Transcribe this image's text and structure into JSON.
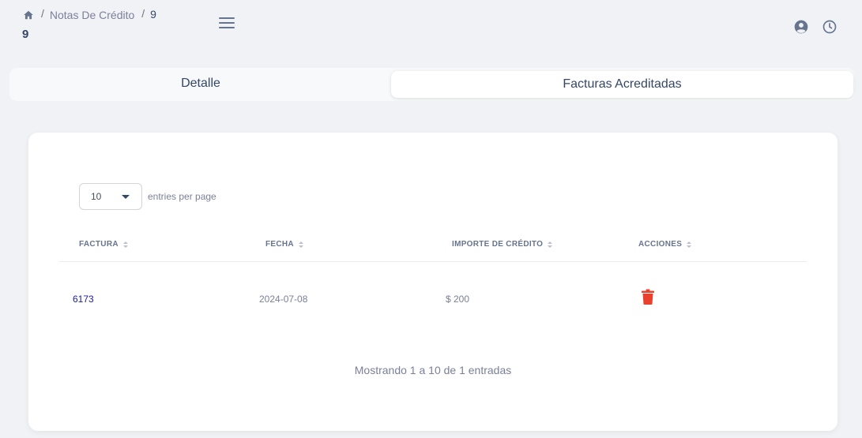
{
  "breadcrumb": {
    "home_icon": "home-icon",
    "separator": "/",
    "link": "Notas De Crédito",
    "current": "9"
  },
  "page_title": "9",
  "header_icons": [
    "menu-icon",
    "user-circle-icon",
    "clock-icon"
  ],
  "tabs": [
    {
      "label": "Detalle",
      "active": false
    },
    {
      "label": "Facturas Acreditadas",
      "active": true
    }
  ],
  "table": {
    "per_page_value": "10",
    "per_page_label": "entries per page",
    "columns": [
      "FACTURA",
      "FECHA",
      "IMPORTE DE CRÉDITO",
      "ACCIONES"
    ],
    "rows": [
      {
        "factura": "6173",
        "fecha": "2024-07-08",
        "importe": "$ 200",
        "accion_icon": "trash-icon"
      }
    ],
    "info": "Mostrando 1 a 10 de 1 entradas"
  },
  "colors": {
    "background": "#f0f2f5",
    "text": "#344767",
    "link": "#1a1aa6",
    "delete": "#e8412e"
  }
}
